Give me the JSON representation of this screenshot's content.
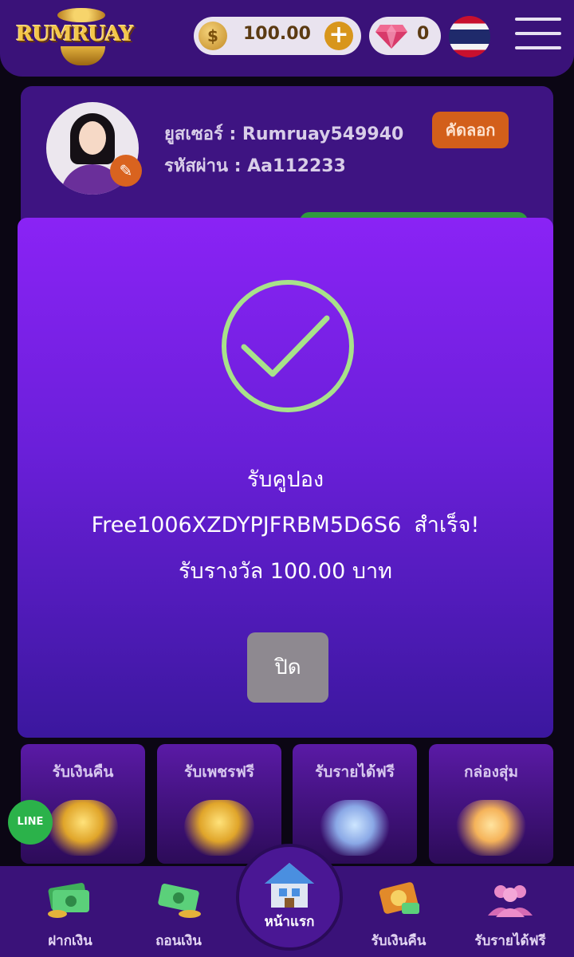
{
  "header": {
    "logo_text": "RUMRUAY",
    "coin_balance": "100.00",
    "coin_symbol": "$",
    "add_symbol": "+",
    "gem_balance": "0",
    "flag_icon": "thailand-flag-icon",
    "menu_icon": "hamburger-menu-icon"
  },
  "profile": {
    "username_line": "ยูสเซอร์ : Rumruay549940",
    "password_line": "รหัสผ่าน : Aa112233",
    "copy_label": "คัดลอก",
    "edit_icon": "pencil-icon"
  },
  "modal": {
    "icon": "check-circle-icon",
    "title": "รับคูปอง",
    "code": "Free1006XZDYPJFRBM5D6S6",
    "status": "สำเร็จ!",
    "reward_line": "รับรางวัล 100.00 บาท",
    "close_label": "ปิด",
    "accent_color": "#a8e28a"
  },
  "features": [
    {
      "label": "รับเงินคืน"
    },
    {
      "label": "รับเพชรฟรี"
    },
    {
      "label": "รับรายได้ฟรี"
    },
    {
      "label": "กล่องสุ่ม"
    }
  ],
  "line_button": {
    "label": "LINE"
  },
  "bottom_nav": {
    "items": [
      {
        "label": "ฝากเงิน",
        "icon": "deposit-money-icon"
      },
      {
        "label": "ถอนเงิน",
        "icon": "withdraw-money-icon"
      },
      {
        "label": "หน้าแรก",
        "icon": "home-icon"
      },
      {
        "label": "รับเงินคืน",
        "icon": "cashback-icon"
      },
      {
        "label": "รับรายได้ฟรี",
        "icon": "free-income-icon"
      }
    ]
  }
}
